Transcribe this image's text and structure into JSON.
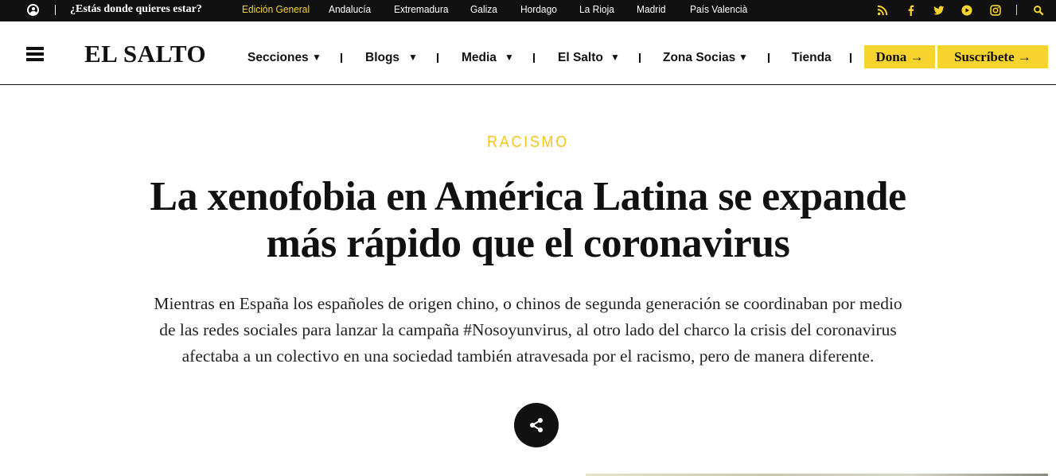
{
  "topbar": {
    "question": "¿Estás donde quieres estar?",
    "editions": [
      {
        "label": "Edición General",
        "active": true
      },
      {
        "label": "Andalucía",
        "active": false
      },
      {
        "label": "Extremadura",
        "active": false
      },
      {
        "label": "Galiza",
        "active": false
      },
      {
        "label": "Hordago",
        "active": false
      },
      {
        "label": "La Rioja",
        "active": false
      },
      {
        "label": "Madrid",
        "active": false
      },
      {
        "label": "País Valencià",
        "active": false
      }
    ],
    "social_icons": [
      "rss-icon",
      "facebook-icon",
      "twitter-icon",
      "youtube-icon",
      "instagram-icon",
      "search-icon"
    ],
    "accent_color": "#f6d32d"
  },
  "header": {
    "logo": "EL SALTO",
    "nav": [
      {
        "label": "Secciones",
        "dropdown": true
      },
      {
        "label": "Blogs",
        "dropdown": true
      },
      {
        "label": "Media",
        "dropdown": true
      },
      {
        "label": "El Salto",
        "dropdown": true
      },
      {
        "label": "Zona Socias",
        "dropdown": true
      },
      {
        "label": "Tienda",
        "dropdown": false
      }
    ],
    "dona_label": "Dona →",
    "suscribete_label": "Suscríbete →"
  },
  "article": {
    "category": "RACISMO",
    "headline_line1": "La xenofobia en América Latina se expande",
    "headline_line2": "más rápido que el coronavirus",
    "lead_line1": "Mientras en España los españoles de origen chino, o chinos de segunda generación se coordinaban por medio",
    "lead_line2": "de las redes sociales para lanzar la campaña #Nosoyunvirus, al otro lado del charco la crisis del coronavirus",
    "lead_line3": "afectaba a un colectivo en una sociedad también atravesada por el racismo, pero de manera diferente."
  }
}
